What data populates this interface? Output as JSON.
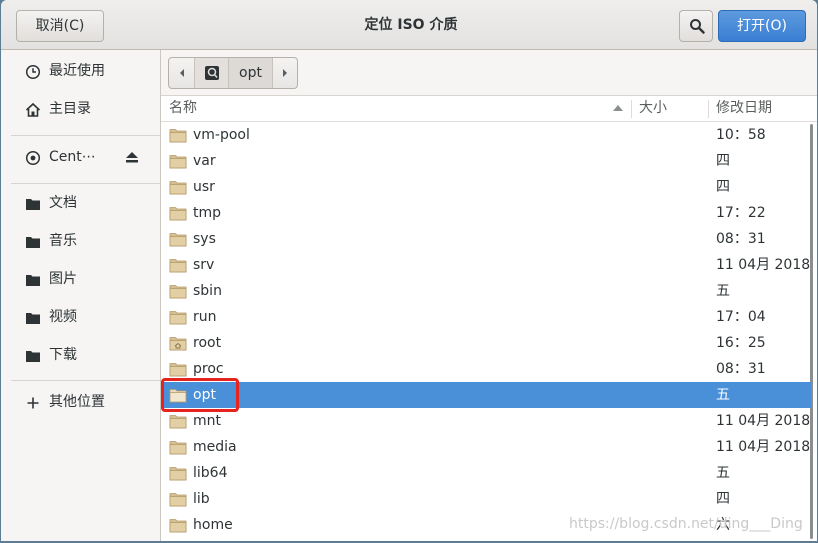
{
  "header": {
    "cancel_label": "取消(C)",
    "title": "定位  ISO 介质",
    "open_label": "打开(O)"
  },
  "sidebar": {
    "items": [
      {
        "label": "最近使用",
        "icon": "clock-icon"
      },
      {
        "label": "主目录",
        "icon": "home-icon"
      },
      {
        "label": "Cent⋯",
        "icon": "disc-icon"
      },
      {
        "label": "文档",
        "icon": "folder-icon"
      },
      {
        "label": "音乐",
        "icon": "folder-icon"
      },
      {
        "label": "图片",
        "icon": "folder-icon"
      },
      {
        "label": "视频",
        "icon": "folder-icon"
      },
      {
        "label": "下载",
        "icon": "folder-icon"
      },
      {
        "label": "其他位置",
        "icon": "plus-icon"
      }
    ]
  },
  "pathbar": {
    "current": "opt"
  },
  "columns": {
    "name": "名称",
    "size": "大小",
    "modified": "修改日期"
  },
  "files": [
    {
      "name": "vm-pool",
      "date": "10：58"
    },
    {
      "name": "var",
      "date": "四"
    },
    {
      "name": "usr",
      "date": "四"
    },
    {
      "name": "tmp",
      "date": "17：22"
    },
    {
      "name": "sys",
      "date": "08：31"
    },
    {
      "name": "srv",
      "date": "11 04月 2018"
    },
    {
      "name": "sbin",
      "date": "五"
    },
    {
      "name": "run",
      "date": "17：04"
    },
    {
      "name": "root",
      "date": "16：25"
    },
    {
      "name": "proc",
      "date": "08：31"
    },
    {
      "name": "opt",
      "date": "五"
    },
    {
      "name": "mnt",
      "date": "11 04月 2018"
    },
    {
      "name": "media",
      "date": "11 04月 2018"
    },
    {
      "name": "lib64",
      "date": "五"
    },
    {
      "name": "lib",
      "date": "四"
    },
    {
      "name": "home",
      "date": "六"
    }
  ],
  "selected_file": "opt",
  "watermark": "https://blog.csdn.net/ding___Ding",
  "colors": {
    "accent": "#4a90d9",
    "highlight": "#e5231f",
    "folder": "#d6bf92"
  }
}
